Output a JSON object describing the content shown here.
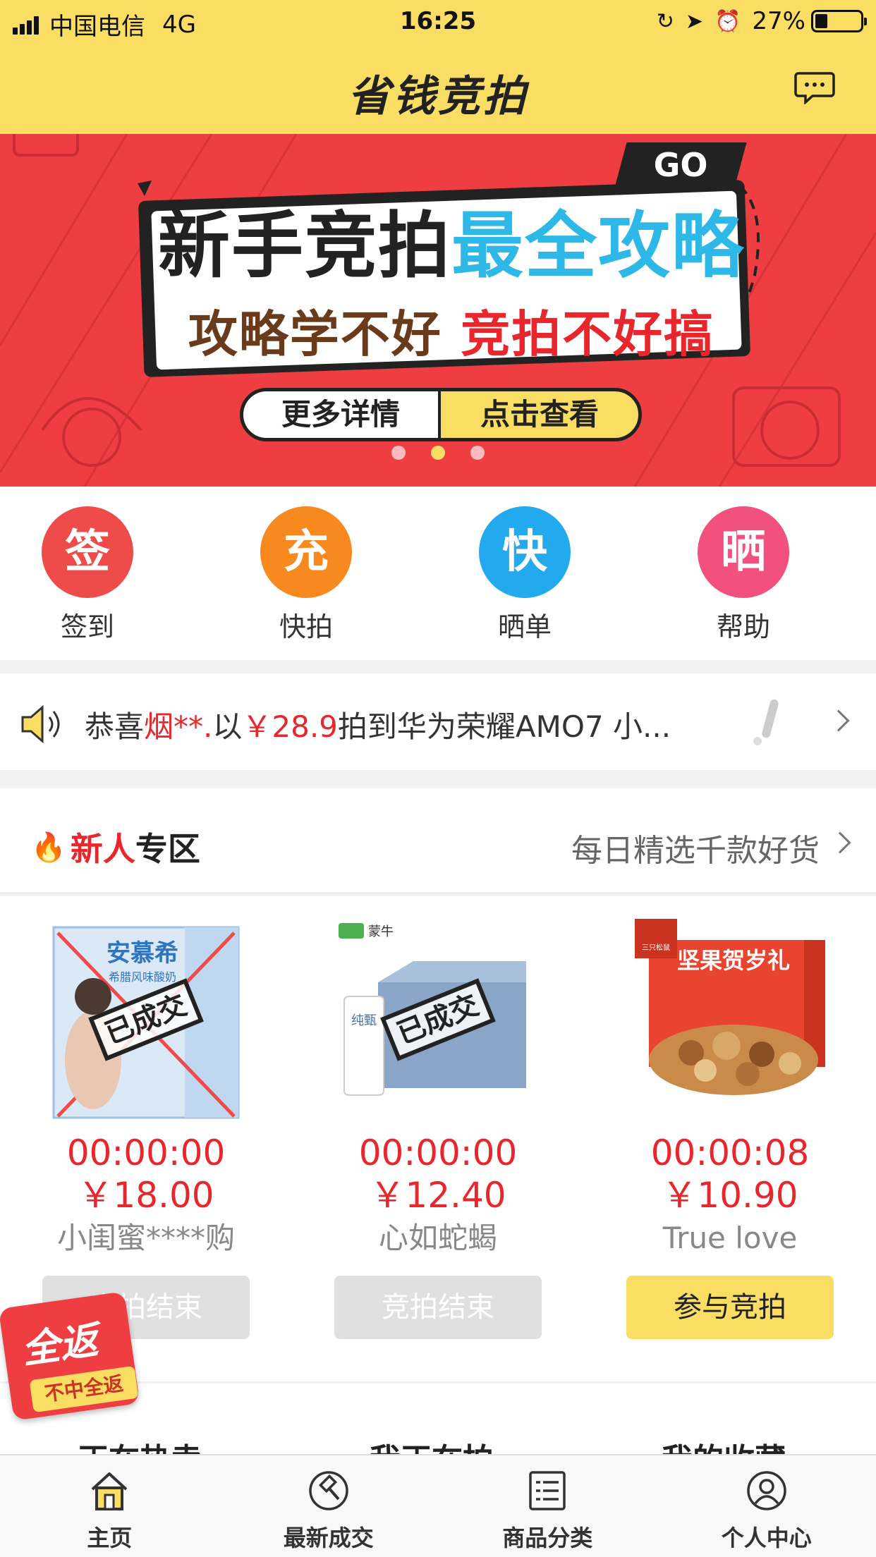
{
  "status_bar": {
    "carrier": "中国电信",
    "network": "4G",
    "time": "16:25",
    "battery": "27%"
  },
  "header": {
    "title": "省钱竞拍",
    "message_icon": "chat-bubble-icon"
  },
  "banner": {
    "go": "GO",
    "headline_black": "新手竞拍",
    "headline_blue": "最全攻略",
    "sub_dark": "攻略学不好",
    "sub_red": "竞拍不好搞",
    "btn_left": "更多详情",
    "btn_right": "点击查看",
    "active_dot": 1
  },
  "quick_menu": [
    {
      "icon_text": "签",
      "label": "签到",
      "color": "#ef4b4b"
    },
    {
      "icon_text": "充",
      "label": "快拍",
      "color": "#f7891f"
    },
    {
      "icon_text": "快",
      "label": "晒单",
      "color": "#23a9ee"
    },
    {
      "icon_text": "晒",
      "label": "帮助",
      "color": "#f2507d"
    }
  ],
  "notice": {
    "prefix": "恭喜",
    "user": "烟**.",
    "mid": "以",
    "price": "￥28.9",
    "suffix": "拍到华为荣耀AMO7 小..."
  },
  "section": {
    "title_red": "新人",
    "title_dark": "专区",
    "more": "每日精选千款好货"
  },
  "products": [
    {
      "time": "00:00:00",
      "price": "￥18.00",
      "name": "小闺蜜****购",
      "button": "竞拍结束",
      "stamp": "已成交",
      "ended": true
    },
    {
      "time": "00:00:00",
      "price": "￥12.40",
      "name": "心如蛇蝎",
      "button": "竞拍结束",
      "stamp": "已成交",
      "ended": true
    },
    {
      "time": "00:00:08",
      "price": "￥10.90",
      "name": "True love",
      "button": "参与竞拍",
      "stamp": "",
      "ended": false
    }
  ],
  "product_images": {
    "p1_brand": "安慕希",
    "p1_sub": "希腊风味酸奶",
    "p2_brand": "蒙牛",
    "p2_sub": "纯甄",
    "p3_title": "坚果贺岁礼",
    "p3_brand": "三只松鼠"
  },
  "lower_tabs": [
    "正在热卖",
    "我正在拍",
    "我的收藏"
  ],
  "promo": {
    "big": "全返",
    "ribbon": "不中全返"
  },
  "tabbar": [
    {
      "label": "主页",
      "icon": "home-icon"
    },
    {
      "label": "最新成交",
      "icon": "gavel-icon"
    },
    {
      "label": "商品分类",
      "icon": "list-icon"
    },
    {
      "label": "个人中心",
      "icon": "user-icon"
    }
  ]
}
